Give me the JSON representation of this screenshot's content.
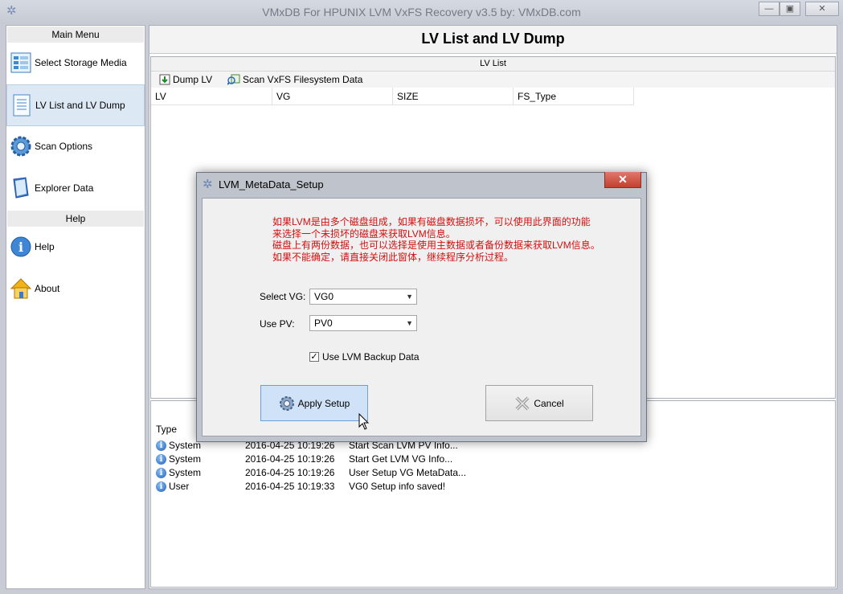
{
  "window": {
    "title": "VMxDB For HPUNIX LVM VxFS Recovery v3.5 by: VMxDB.com",
    "minimize_label": "—",
    "restore_label": "▣",
    "close_label": "✕"
  },
  "sidebar": {
    "main_menu_header": "Main Menu",
    "items": [
      {
        "label": "Select Storage Media",
        "icon": "storage-media-icon"
      },
      {
        "label": "LV List and LV Dump",
        "icon": "list-icon",
        "selected": true
      },
      {
        "label": "Scan Options",
        "icon": "gear-icon"
      },
      {
        "label": "Explorer Data",
        "icon": "book-icon"
      }
    ],
    "help_header": "Help",
    "help_items": [
      {
        "label": "Help",
        "icon": "info-icon"
      },
      {
        "label": "About",
        "icon": "home-icon"
      }
    ]
  },
  "main": {
    "title": "LV List and LV Dump",
    "lv_panel": {
      "caption": "LV List",
      "toolbar": {
        "dump_label": "Dump LV",
        "scan_label": "Scan VxFS Filesystem Data"
      },
      "columns": [
        "LV",
        "VG",
        "SIZE",
        "FS_Type"
      ]
    },
    "log": {
      "columns": [
        "Type"
      ],
      "rows": [
        {
          "type": "System",
          "time": "2016-04-25 10:19:26",
          "message": "Start Scan LVM PV Info..."
        },
        {
          "type": "System",
          "time": "2016-04-25 10:19:26",
          "message": "Start Get LVM VG Info..."
        },
        {
          "type": "System",
          "time": "2016-04-25 10:19:26",
          "message": "User Setup VG MetaData..."
        },
        {
          "type": "User",
          "time": "2016-04-25 10:19:33",
          "message": "VG0 Setup info saved!"
        }
      ]
    }
  },
  "dialog": {
    "title": "LVM_MetaData_Setup",
    "close_label": "✕",
    "notice_lines": [
      "如果LVM是由多个磁盘组成，如果有磁盘数据损坏，可以使用此界面的功能",
      "来选择一个未损坏的磁盘来获取LVM信息。",
      "磁盘上有两份数据，也可以选择是使用主数据或者备份数据来获取LVM信息。",
      "如果不能确定，请直接关闭此窗体，继续程序分析过程。"
    ],
    "select_vg_label": "Select VG:",
    "select_vg_value": "VG0",
    "use_pv_label": "Use PV:",
    "use_pv_value": "PV0",
    "backup_checkbox_label": "Use LVM Backup Data",
    "backup_checked": true,
    "apply_label": "Apply Setup",
    "cancel_label": "Cancel"
  },
  "colors": {
    "notice_text": "#d21010",
    "selected_bg": "#dde8f5",
    "apply_bg": "#cfe2f7"
  }
}
